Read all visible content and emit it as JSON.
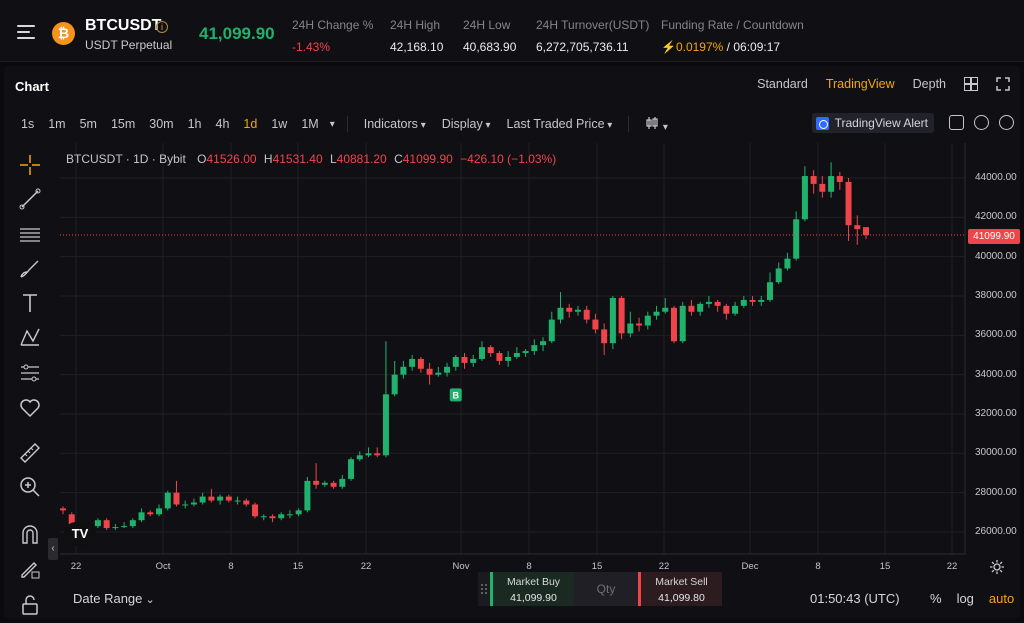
{
  "header": {
    "menu_icon": "hamburger-menu-icon",
    "coin_icon": "bitcoin-icon",
    "coin_glyph": "₿",
    "symbol": "BTCUSDT",
    "info_glyph": "i",
    "subtitle": "USDT Perpetual",
    "last_price": "41,099.90",
    "stats": [
      {
        "label": "24H Change %",
        "value": "-1.43%"
      },
      {
        "label": "24H High",
        "value": "42,168.10"
      },
      {
        "label": "24H Low",
        "value": "40,683.90"
      },
      {
        "label": "24H Turnover(USDT)",
        "value": "6,272,705,736.11"
      }
    ],
    "funding": {
      "label": "Funding Rate / Countdown",
      "bolt": "⚡",
      "rate": "0.0197%",
      "separator": " / ",
      "countdown": "06:09:17"
    },
    "colors": {
      "up": "#20b26c",
      "down": "#ef454a",
      "accent": "#f7a600"
    }
  },
  "panel": {
    "title": "Chart",
    "views": [
      "Standard",
      "TradingView",
      "Depth"
    ],
    "active_view": "TradingView"
  },
  "toolbar": {
    "timeframes": [
      "1s",
      "1m",
      "5m",
      "15m",
      "30m",
      "1h",
      "4h",
      "1d",
      "1w",
      "1M"
    ],
    "active_timeframe": "1d",
    "more_glyph": "▾",
    "indicators": "Indicators",
    "display": "Display",
    "price_type": "Last Traded Price",
    "alert": "TradingView Alert"
  },
  "left_tools": [
    "crosshair-icon",
    "trend-line-icon",
    "horizontal-lines-icon",
    "brush-icon",
    "text-icon",
    "pattern-icon",
    "forecast-icon",
    "favorite-heart-icon",
    "ruler-icon",
    "zoom-in-icon",
    "magnet-icon",
    "pencil-lock-icon",
    "lock-icon"
  ],
  "legend": {
    "symbol_line": "BTCUSDT · 1D · Bybit",
    "open_label": "O",
    "open": "41526.00",
    "high_label": "H",
    "high": "41531.40",
    "low_label": "L",
    "low": "40881.20",
    "close_label": "C",
    "close": "41099.90",
    "change": "−426.10 (−1.03%)"
  },
  "chart_data": {
    "type": "candlestick",
    "y_ticks": [
      "44000.00",
      "42000.00",
      "40000.00",
      "38000.00",
      "36000.00",
      "34000.00",
      "32000.00",
      "30000.00",
      "28000.00",
      "26000.00"
    ],
    "ylim": [
      25000,
      45500
    ],
    "x_ticks": [
      "22",
      "Oct",
      "8",
      "15",
      "22",
      "Nov",
      "8",
      "15",
      "22",
      "Dec",
      "8",
      "15",
      "22"
    ],
    "current_price_label": "41099.90",
    "current_price": 41099.9,
    "marker_label": "B",
    "candles": [
      [
        27200,
        27100,
        27300,
        26900
      ],
      [
        26900,
        26300,
        27000,
        26200
      ],
      [
        26300,
        26200,
        26500,
        26100
      ],
      [
        26200,
        26300,
        26400,
        26100
      ],
      [
        26300,
        26600,
        26700,
        26200
      ],
      [
        26600,
        26200,
        26700,
        26100
      ],
      [
        26200,
        26250,
        26400,
        26100
      ],
      [
        26250,
        26300,
        26500,
        26200
      ],
      [
        26300,
        26600,
        26700,
        26200
      ],
      [
        26600,
        27000,
        27200,
        26500
      ],
      [
        27000,
        26900,
        27100,
        26800
      ],
      [
        26900,
        27200,
        27400,
        26800
      ],
      [
        27200,
        28000,
        28100,
        27100
      ],
      [
        28000,
        27400,
        28600,
        27300
      ],
      [
        27400,
        27400,
        27600,
        27200
      ],
      [
        27400,
        27500,
        27700,
        27300
      ],
      [
        27500,
        27800,
        28000,
        27400
      ],
      [
        27800,
        27600,
        28200,
        27500
      ],
      [
        27600,
        27800,
        27900,
        27400
      ],
      [
        27800,
        27600,
        27900,
        27500
      ],
      [
        27600,
        27600,
        27800,
        27400
      ],
      [
        27600,
        27400,
        27700,
        27300
      ],
      [
        27400,
        26800,
        27500,
        26700
      ],
      [
        26800,
        26800,
        26900,
        26600
      ],
      [
        26800,
        26700,
        26900,
        26500
      ],
      [
        26700,
        26900,
        27000,
        26600
      ],
      [
        26900,
        26900,
        27100,
        26700
      ],
      [
        26900,
        27100,
        27200,
        26800
      ],
      [
        27100,
        28600,
        28800,
        27000
      ],
      [
        28600,
        28400,
        29500,
        28200
      ],
      [
        28400,
        28500,
        28600,
        28300
      ],
      [
        28500,
        28300,
        28600,
        28200
      ],
      [
        28300,
        28700,
        28900,
        28200
      ],
      [
        28700,
        29700,
        29800,
        28600
      ],
      [
        29700,
        29900,
        30100,
        29600
      ],
      [
        29900,
        30000,
        30300,
        29800
      ],
      [
        30000,
        29900,
        30300,
        29800
      ],
      [
        29900,
        33000,
        35700,
        29800
      ],
      [
        33000,
        34000,
        34700,
        32900
      ],
      [
        34000,
        34400,
        34700,
        33800
      ],
      [
        34400,
        34800,
        35000,
        34200
      ],
      [
        34800,
        34300,
        34900,
        34100
      ],
      [
        34300,
        34000,
        34600,
        33500
      ],
      [
        34000,
        34100,
        34400,
        33900
      ],
      [
        34100,
        34400,
        34600,
        33900
      ],
      [
        34400,
        34900,
        35000,
        34200
      ],
      [
        34900,
        34600,
        35100,
        34300
      ],
      [
        34600,
        34800,
        35000,
        34400
      ],
      [
        34800,
        35400,
        35700,
        34700
      ],
      [
        35400,
        35100,
        35500,
        34900
      ],
      [
        35100,
        34700,
        35200,
        34500
      ],
      [
        34700,
        34900,
        35200,
        34400
      ],
      [
        34900,
        35100,
        35400,
        34800
      ],
      [
        35100,
        35200,
        35300,
        34900
      ],
      [
        35200,
        35500,
        35800,
        35000
      ],
      [
        35500,
        35700,
        35900,
        35200
      ],
      [
        35700,
        36800,
        37200,
        35600
      ],
      [
        36800,
        37400,
        38200,
        36600
      ],
      [
        37400,
        37200,
        37600,
        36900
      ],
      [
        37200,
        37300,
        37500,
        37000
      ],
      [
        37300,
        36800,
        37500,
        36600
      ],
      [
        36800,
        36300,
        37100,
        36100
      ],
      [
        36300,
        35600,
        36600,
        35000
      ],
      [
        35600,
        37900,
        38000,
        35300
      ],
      [
        37900,
        36100,
        38000,
        35800
      ],
      [
        36100,
        36600,
        37200,
        35900
      ],
      [
        36600,
        36500,
        36900,
        36200
      ],
      [
        36500,
        37000,
        37200,
        36300
      ],
      [
        37000,
        37200,
        37500,
        36800
      ],
      [
        37200,
        37400,
        37900,
        37100
      ],
      [
        37400,
        35700,
        37500,
        35600
      ],
      [
        35700,
        37500,
        37700,
        35600
      ],
      [
        37500,
        37200,
        37800,
        37000
      ],
      [
        37200,
        37600,
        37700,
        37000
      ],
      [
        37600,
        37700,
        38000,
        37400
      ],
      [
        37700,
        37500,
        37800,
        37200
      ],
      [
        37500,
        37100,
        37600,
        36800
      ],
      [
        37100,
        37500,
        37700,
        37000
      ],
      [
        37500,
        37800,
        38000,
        37400
      ],
      [
        37800,
        37700,
        38000,
        37500
      ],
      [
        37700,
        37800,
        38000,
        37500
      ],
      [
        37800,
        38700,
        39200,
        37700
      ],
      [
        38700,
        39400,
        39700,
        38600
      ],
      [
        39400,
        39900,
        40200,
        39300
      ],
      [
        39900,
        41900,
        42300,
        39800
      ],
      [
        41900,
        44100,
        44600,
        41800
      ],
      [
        44100,
        43700,
        44400,
        43200
      ],
      [
        43700,
        43300,
        44100,
        43000
      ],
      [
        43300,
        44100,
        44800,
        43000
      ],
      [
        44100,
        43800,
        44300,
        43400
      ],
      [
        43800,
        41600,
        44000,
        40800
      ],
      [
        41600,
        41400,
        42100,
        40600
      ],
      [
        41500,
        41100,
        41500,
        40900
      ]
    ]
  },
  "bottom": {
    "date_range": "Date Range",
    "collapse_glyph": "‹",
    "tv_logo": "TV",
    "market_buy_label": "Market Buy",
    "market_buy_price": "41,099.90",
    "qty_placeholder": "Qty",
    "market_sell_label": "Market Sell",
    "market_sell_price": "41,099.80",
    "utc_time": "01:50:43 (UTC)",
    "pct": "%",
    "log": "log",
    "auto": "auto"
  }
}
